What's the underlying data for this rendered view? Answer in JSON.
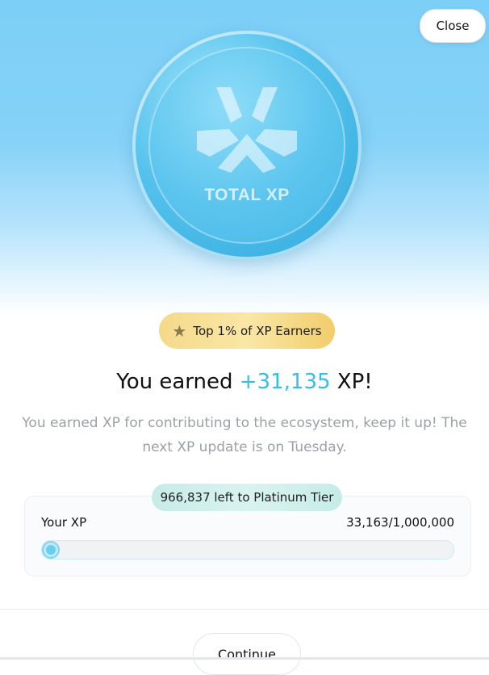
{
  "header": {
    "close_label": "Close"
  },
  "coin": {
    "label": "TOTAL XP",
    "logo_icon": "xp-logo-icon"
  },
  "badge": {
    "text": "Top 1% of XP Earners",
    "icon": "star-icon"
  },
  "headline": {
    "prefix": "You earned ",
    "amount": "+31,135",
    "suffix": " XP!"
  },
  "description": "You earned XP for contributing to the ecosystem, keep it up! The next XP update is on Tuesday.",
  "progress": {
    "tier_note": "966,837 left to Platinum Tier",
    "label": "Your XP",
    "count": "33,163/1,000,000",
    "fraction": 0.033163
  },
  "footer": {
    "continue_label": "Continue"
  },
  "colors": {
    "accent": "#38bde8",
    "sky": "#7ccff7",
    "badge_gold": "#f5d98a",
    "pill_teal": "#c6ece8"
  }
}
